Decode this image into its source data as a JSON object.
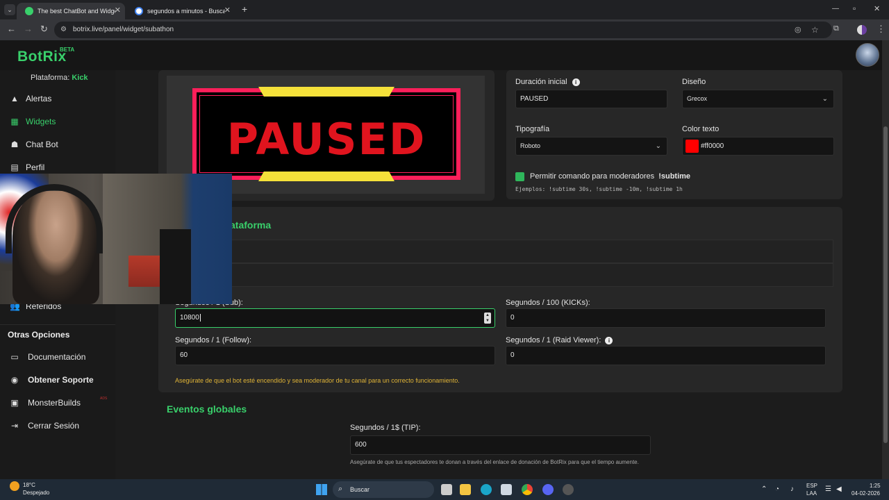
{
  "browser": {
    "tabs": [
      {
        "title": "The best ChatBot and Widgets",
        "active": true
      },
      {
        "title": "segundos a minutos - Buscar c",
        "active": false
      }
    ],
    "new_tab": "+",
    "url": "botrix.live/panel/widget/subathon",
    "window_controls": {
      "minimize": "—",
      "maximize": "▫",
      "close": "✕"
    }
  },
  "app": {
    "logo": "BotRix",
    "logo_badge": "BETA"
  },
  "sidebar": {
    "platform_label": "Plataforma:",
    "platform_value": "Kick",
    "items": [
      {
        "label": "Alertas",
        "icon": "warning-icon"
      },
      {
        "label": "Widgets",
        "icon": "grid-icon",
        "active": true
      },
      {
        "label": "Chat Bot",
        "icon": "robot-icon"
      },
      {
        "label": "Perfil",
        "icon": "id-card-icon"
      },
      {
        "label": "Referidos",
        "icon": "users-icon"
      }
    ],
    "section_title": "Otras Opciones",
    "other_items": [
      {
        "label": "Documentación",
        "icon": "book-icon"
      },
      {
        "label": "Obtener Soporte",
        "icon": "support-icon"
      },
      {
        "label": "MonsterBuilds",
        "icon": "monitor-icon",
        "badge": "ADS"
      },
      {
        "label": "Cerrar Sesión",
        "icon": "logout-icon"
      }
    ]
  },
  "preview": {
    "text": "PAUSED",
    "text_color": "#e0141e",
    "frame_color": "#ff1f5a",
    "accent_color": "#f5e13a"
  },
  "settings": {
    "initial_duration_label": "Duración inicial",
    "initial_duration_value": "PAUSED",
    "design_label": "Diseño",
    "design_value": "Grecox",
    "typography_label": "Tipografía",
    "typography_value": "Roboto",
    "text_color_label": "Color texto",
    "text_color_value": "#ff0000",
    "text_color_swatch": "#ff0000",
    "mod_command_label": "Permitir comando para moderadores",
    "mod_command_name": "!subtime",
    "mod_command_checked": true,
    "examples": "Ejemplos: !subtime 30s, !subtime -10m, !subtime 1h"
  },
  "platform_events": {
    "title_visible": "ataforma",
    "fields": {
      "sub_label": "Segundos / 1 (Sub):",
      "sub_value": "10800",
      "kicks_label": "Segundos / 100 (KICKs):",
      "kicks_value": "0",
      "follow_label": "Segundos / 1 (Follow):",
      "follow_value": "60",
      "raid_label": "Segundos / 1 (Raid Viewer):",
      "raid_value": "0"
    },
    "note": "Asegúrate de que el bot esté encendido y sea moderador de tu canal para un correcto funcionamiento."
  },
  "global_events": {
    "title": "Eventos globales",
    "tip_label": "Segundos / 1$ (TIP):",
    "tip_value": "600",
    "note": "Asegúrate de que tus espectadores te donan a través del enlace de donación de BotRix para que el tiempo aumente."
  },
  "taskbar": {
    "weather_temp": "18°C",
    "weather_desc": "Despejado",
    "search_label": "Buscar",
    "lang_top": "ESP",
    "lang_bottom": "LAA",
    "time": "1:25",
    "date": "04-02-2026"
  }
}
